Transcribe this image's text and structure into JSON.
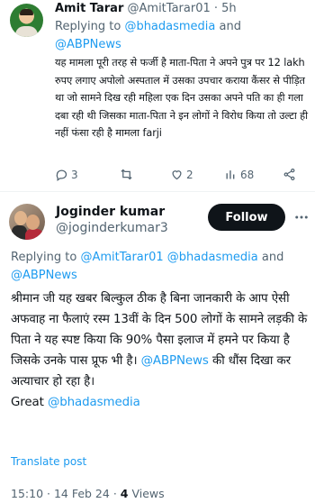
{
  "reply": {
    "author_name": "Amit Tarar",
    "author_handle": "@AmitTarar01",
    "time": "5h",
    "replying_label": "Replying to",
    "replying_to": [
      "@bhadasmedia",
      "and",
      "@ABPNews"
    ],
    "text": "यह मामला पूरी तरह से फर्जी है माता-पिता ने अपने पुत्र पर 12 lakh रुपए लगाए अपोलो अस्पताल में उसका उपचार कराया कैंसर से पीड़ित था जो सामने दिख रही महिला एक दिन उसका अपने पति का ही गला दबा रही थी जिसका माता-पिता ने इन लोगों ने विरोध किया तो उल्टा ही नहीं फंसा रही है  मामला farji",
    "actions": {
      "replies": "3",
      "likes": "2",
      "views": "68"
    }
  },
  "tweet": {
    "author_name": "Joginder kumar",
    "author_handle": "@joginderkumar3",
    "follow_label": "Follow",
    "replying_label": "Replying to",
    "replying_to": [
      "@AmitTarar01",
      "@bhadasmedia",
      "and",
      "@ABPNews"
    ],
    "text_part1": "श्रीमान जी यह खबर बिल्कुल ठीक है बिना जानकारी के आप ऐसी अफवाह ना फैलाएं रस्म 13वीं के दिन 500 लोगों के सामने लड़की के पिता ने यह स्पष्ट किया कि 90% पैसा इलाज में हमने पर किया है जिसके उनके पास प्रूफ भी है।",
    "text_mention": "@ABPNews",
    "text_part2": "की धौंस दिखा कर अत्याचार हो रहा है।",
    "text_greeting": "Great",
    "text_mention2": "@bhadasmedia",
    "translate_label": "Translate post",
    "time": "15:10",
    "date": "14 Feb 24",
    "views_count": "4",
    "views_label": "Views"
  },
  "colors": {
    "accent": "#1d9bf0",
    "muted": "#536471",
    "text": "#0f1419",
    "follow_bg": "#0f1419"
  }
}
